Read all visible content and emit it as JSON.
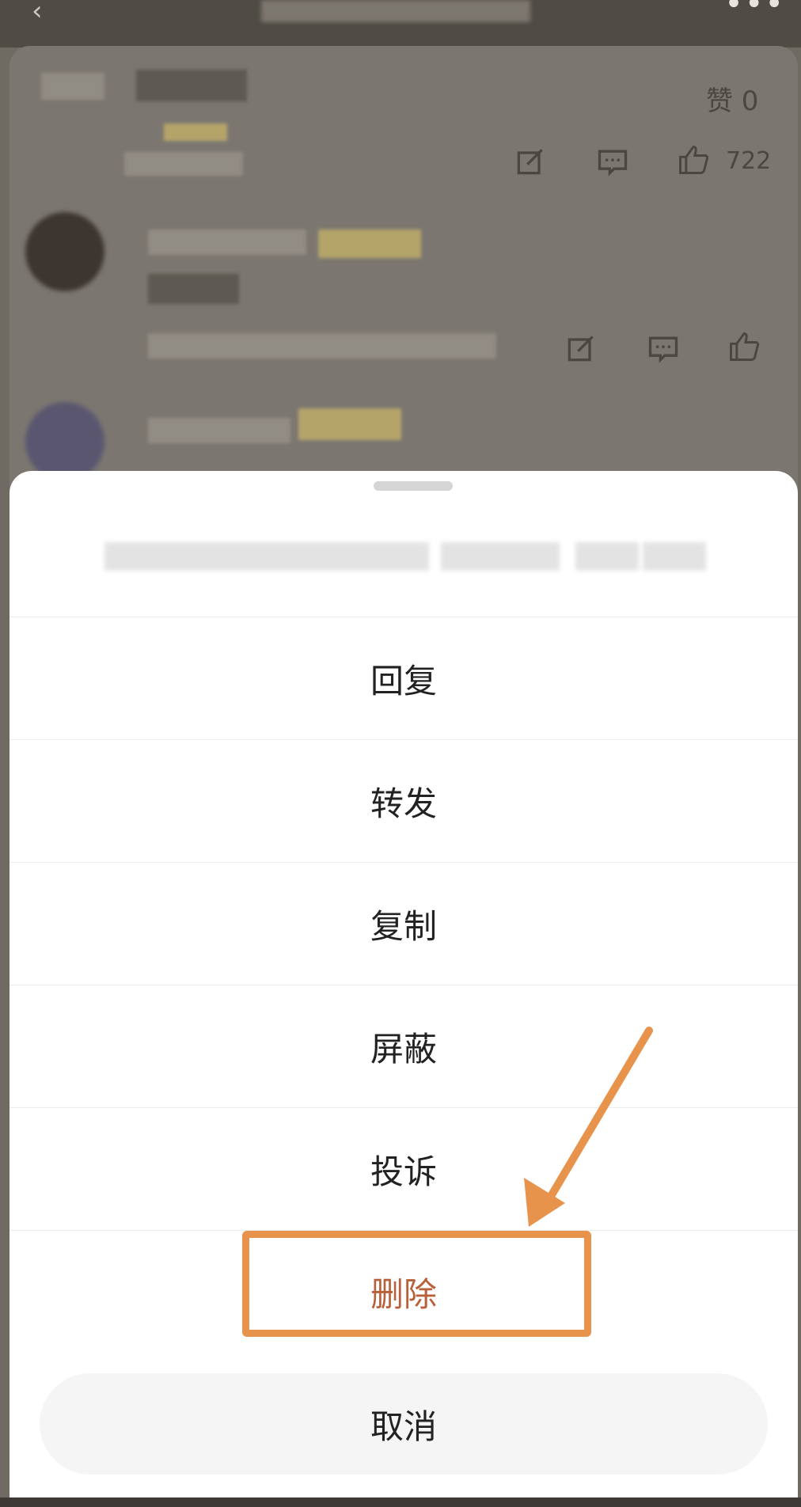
{
  "feed": {
    "likes_label": "赞 0",
    "post_like_count": "722",
    "icons": [
      "edit-icon",
      "comment-icon",
      "thumbs-up-icon"
    ]
  },
  "sheet": {
    "actions": [
      {
        "label": "回复",
        "danger": false
      },
      {
        "label": "转发",
        "danger": false
      },
      {
        "label": "复制",
        "danger": false
      },
      {
        "label": "屏蔽",
        "danger": false
      },
      {
        "label": "投诉",
        "danger": false
      },
      {
        "label": "删除",
        "danger": true
      }
    ],
    "cancel_label": "取消"
  },
  "colors": {
    "danger_text": "#b8603a",
    "annotation": "#e8934b",
    "overlay": "#6f6a62"
  }
}
